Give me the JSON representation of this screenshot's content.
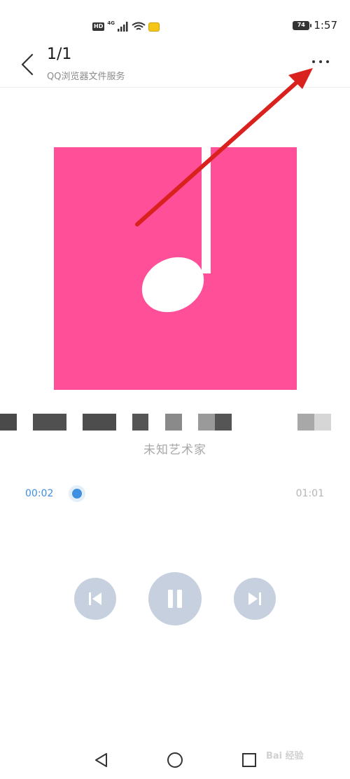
{
  "status_bar": {
    "hd": "HD",
    "network": "4G",
    "battery": "74",
    "time": "1:57"
  },
  "header": {
    "page_count": "1/1",
    "subtitle": "QQ浏览器文件服务"
  },
  "player": {
    "artist": "未知艺术家",
    "elapsed": "00:02",
    "duration": "01:01",
    "progress": 0.03
  },
  "watermark": "Bai 经验",
  "colors": {
    "album": "#ff4f99",
    "accent": "#3d8fe0",
    "control": "#c7d0de",
    "annotation": "#d9211d"
  },
  "icons": [
    "back-icon",
    "more-icon",
    "music-note-icon",
    "previous-icon",
    "pause-icon",
    "next-icon"
  ]
}
